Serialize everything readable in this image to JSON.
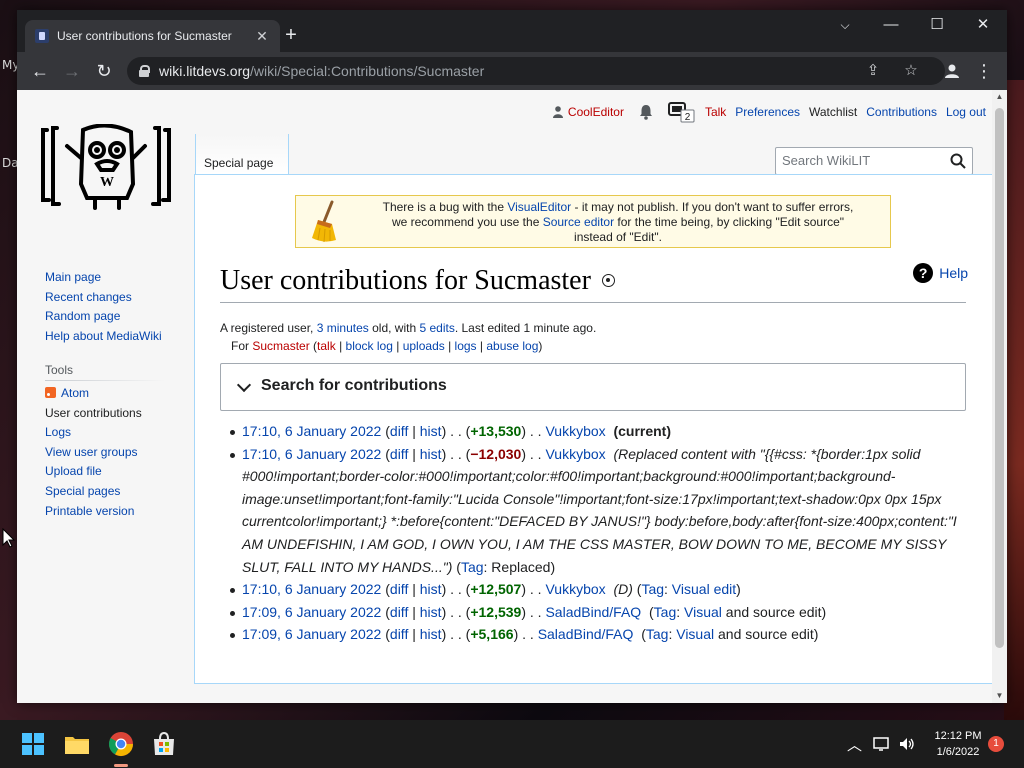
{
  "desktop": {
    "labels": [
      "My",
      "Da"
    ]
  },
  "browser": {
    "tab_title": "User contributions for Sucmaster",
    "url_host": "wiki.litdevs.org",
    "url_path": "/wiki/Special:Contributions/Sucmaster"
  },
  "personal": {
    "user": "CoolEditor",
    "notifications_count": "2",
    "talk": "Talk",
    "preferences": "Preferences",
    "watchlist": "Watchlist",
    "contributions": "Contributions",
    "logout": "Log out"
  },
  "tabs": {
    "special": "Special page"
  },
  "search": {
    "placeholder": "Search WikiLIT"
  },
  "sidebar": {
    "nav": [
      "Main page",
      "Recent changes",
      "Random page",
      "Help about MediaWiki"
    ],
    "tools_heading": "Tools",
    "tools": [
      "Atom",
      "User contributions",
      "Logs",
      "View user groups",
      "Upload file",
      "Special pages",
      "Printable version"
    ]
  },
  "sitenotice": {
    "t1": "There is a bug with the ",
    "link1": "VisualEditor",
    "t2": " - it may not publish. If you don't want to suffer errors,",
    "t3": "we recommend you use the ",
    "link2": "Source editor",
    "t4": " for the time being, by clicking \"Edit source\"",
    "t5": "instead of \"Edit\"."
  },
  "heading": {
    "title": "User contributions for Sucmaster",
    "help": "Help"
  },
  "subtitle": {
    "t1": "A registered user, ",
    "age": "3 minutes",
    "t2": " old, with ",
    "edits": "5 edits",
    "t3": ". Last edited ",
    "last": "1 minute ago",
    "t4": "."
  },
  "tools_line": {
    "for": "For ",
    "user": "Sucmaster",
    "talk": "talk",
    "block_log": "block log",
    "uploads": "uploads",
    "logs": "logs",
    "abuse_log": "abuse log"
  },
  "search_panel": {
    "label": "Search for contributions"
  },
  "contributions": [
    {
      "date": "17:10, 6 January 2022",
      "diff": "diff",
      "hist": "hist",
      "size": "+13,530",
      "page": "Vukkybox",
      "current": "(current)"
    },
    {
      "date": "17:10, 6 January 2022",
      "diff": "diff",
      "hist": "hist",
      "size": "−12,030",
      "page": "Vukkybox",
      "summary_l1": "(Replaced content with \"{{#css: *{border:1px solid",
      "summary_l2": "#000!important;border-color:#000!important;color:#f00!important;background:#000!important;background-",
      "summary_l3": "image:unset!important;font-family:\"Lucida Console\"!important;font-size:17px!important;text-shadow:0px 0px 15px",
      "summary_l4": "currentcolor!important;} *:before{content:\"DEFACED BY JANUS!\"} body:before,body:after{font-size:400px;content:\"I",
      "summary_l5": "AM UNDEFISHIN, I AM GOD, I OWN YOU, I AM THE CSS MASTER, BOW DOWN TO ME, BECOME MY SISSY",
      "summary_l6": "SLUT, FALL INTO MY HANDS...\")",
      "tag_label": "Tag",
      "tag": "Replaced"
    },
    {
      "date": "17:10, 6 January 2022",
      "diff": "diff",
      "hist": "hist",
      "size": "+12,507",
      "page": "Vukkybox",
      "flag": "(D)",
      "tag_label": "Tag",
      "tag": "Visual edit"
    },
    {
      "date": "17:09, 6 January 2022",
      "diff": "diff",
      "hist": "hist",
      "size": "+12,539",
      "page": "SaladBind/FAQ",
      "tag_label": "Tag",
      "tag": "Visual",
      "tag_rest": " and source edit"
    },
    {
      "date": "17:09, 6 January 2022",
      "diff": "diff",
      "hist": "hist",
      "size": "+5,166",
      "page": "SaladBind/FAQ",
      "tag_label": "Tag",
      "tag": "Visual",
      "tag_rest": " and source edit"
    }
  ],
  "taskbar": {
    "time": "12:12 PM",
    "date": "1/6/2022",
    "notifications": "1"
  },
  "colors": {
    "link": "#0645ad",
    "redlink": "#ba0000",
    "positive": "#006400",
    "negative": "#8b0000"
  }
}
